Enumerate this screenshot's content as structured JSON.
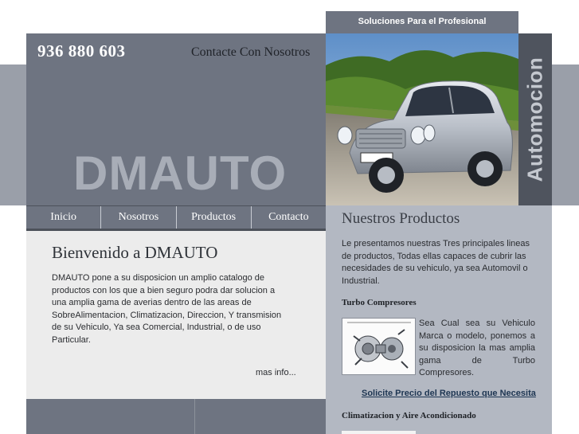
{
  "header": {
    "phone": "936 880 603",
    "contact_label": "Contacte Con Nosotros",
    "brand": "DMAUTO",
    "tagline": "Soluciones Para el Profesional",
    "vertical_label": "Automocion"
  },
  "nav": {
    "items": [
      {
        "label": "Inicio"
      },
      {
        "label": "Nosotros"
      },
      {
        "label": "Productos"
      },
      {
        "label": "Contacto"
      }
    ]
  },
  "main": {
    "title": "Bienvenido a DMAUTO",
    "body": "DMAUTO pone a su disposicion un amplio catalogo de productos con los que a bien seguro podra dar solucion a una amplia gama de averias dentro de las areas de SobreAlimentacion, Climatizacion, Direccion, Y transmision de su Vehiculo, Ya sea Comercial, Industrial, o de uso Particular.",
    "more_link": "mas info..."
  },
  "sidebar": {
    "title": "Nuestros Productos",
    "intro": "Le presentamos nuestras Tres principales lineas de productos, Todas ellas capaces de cubrir las necesidades de su vehiculo, ya sea Automovil o Industrial.",
    "section1_title": "Turbo Compresores",
    "section1_text": "Sea Cual sea su Vehiculo Marca o modelo, ponemos a su disposicion la mas amplia gama de Turbo",
    "section1_text_last": "Compresores.",
    "quote_link": "Solicite Precio del Repuesto que Necesita",
    "section2_title": "Climatizacion y Aire Acondicionado"
  },
  "colors": {
    "header_gray": "#6e7481",
    "band_gray": "#9a9fa9",
    "sidebar_gray": "#b3b8c2",
    "main_bg": "#ececec",
    "car_silver": "#c9ced6"
  }
}
